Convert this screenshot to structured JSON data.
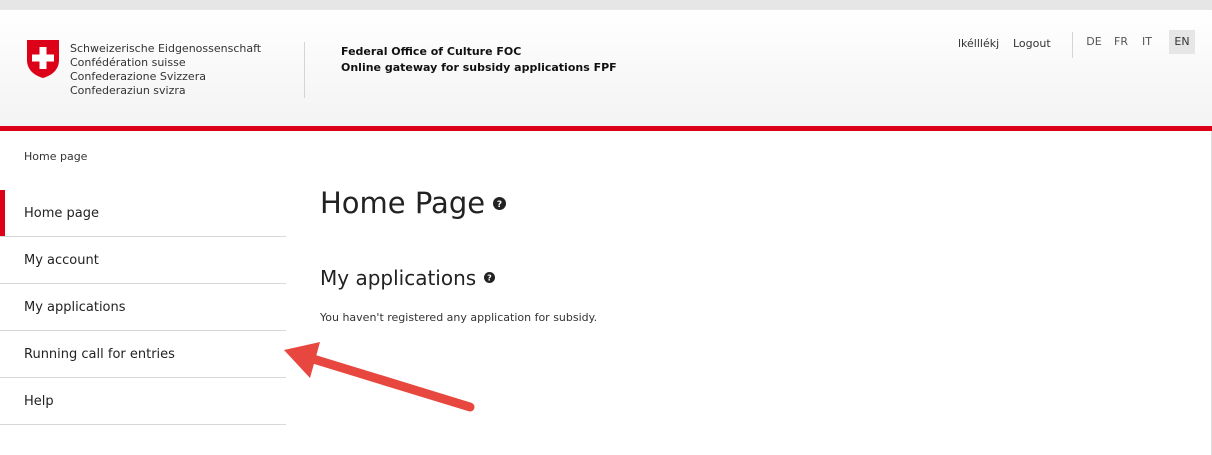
{
  "confederation": [
    "Schweizerische Eidgenossenschaft",
    "Confédération suisse",
    "Confederazione Svizzera",
    "Confederaziun svizra"
  ],
  "office": {
    "line1": "Federal Office of Culture FOC",
    "line2": "Online gateway for subsidy applications FPF"
  },
  "user": {
    "name": "lkélllékj",
    "logout": "Logout"
  },
  "languages": [
    "DE",
    "FR",
    "IT",
    "EN"
  ],
  "active_language": "EN",
  "breadcrumb": "Home page",
  "nav": [
    "Home page",
    "My account",
    "My applications",
    "Running call for entries",
    "Help"
  ],
  "page_title": "Home Page",
  "applications": {
    "heading": "My applications",
    "empty_text": "You haven't registered any application for subsidy."
  },
  "colors": {
    "accent_red": "#dc0018",
    "annotation_arrow": "#e8473f"
  }
}
